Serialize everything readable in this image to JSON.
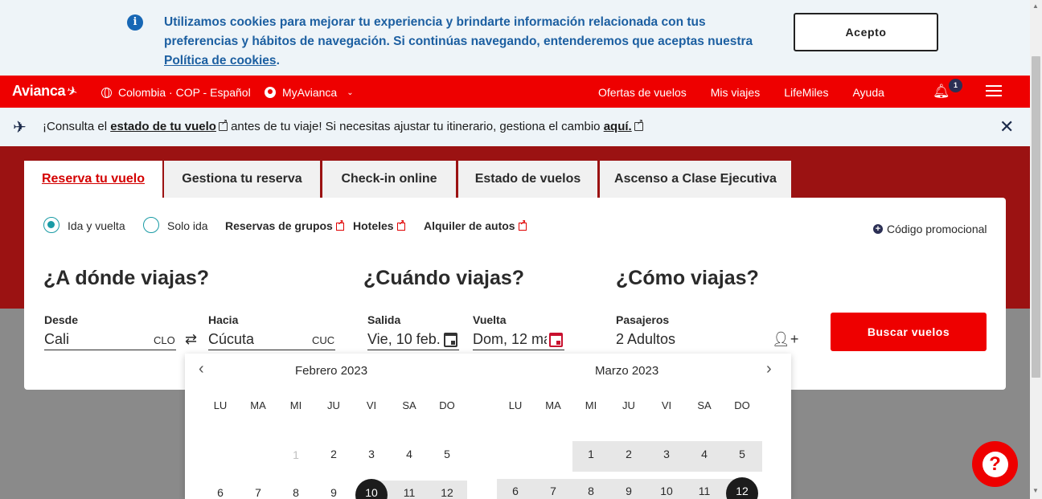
{
  "cookie": {
    "text": "Utilizamos cookies para mejorar tu experiencia y brindarte información relacionada con tus preferencias y hábitos de navegación. Si continúas navegando, entenderemos que aceptas nuestra",
    "link": "Política de cookies",
    "period": ".",
    "accept": "Acepto"
  },
  "nav": {
    "logo": "Avianca",
    "locale": "Colombia · COP - Español",
    "myavianca": "MyAvianca",
    "links": [
      "Ofertas de vuelos",
      "Mis viajes",
      "LifeMiles",
      "Ayuda"
    ],
    "notifications": "1"
  },
  "notice": {
    "pre": "¡Consulta el",
    "link1": "estado de tu vuelo",
    "mid": "antes de tu viaje! Si necesitas ajustar tu itinerario, gestiona el cambio",
    "link2": "aquí."
  },
  "tabs": [
    "Reserva tu vuelo",
    "Gestiona tu reserva",
    "Check-in online",
    "Estado de vuelos",
    "Ascenso a Clase Ejecutiva"
  ],
  "options": {
    "roundtrip": "Ida y vuelta",
    "oneway": "Solo ida",
    "groups": "Reservas de grupos",
    "hotels": "Hoteles",
    "cars": "Alquiler de autos",
    "promo": "Código promocional"
  },
  "headings": {
    "where": "¿A dónde viajas?",
    "when": "¿Cuándo viajas?",
    "how": "¿Cómo viajas?"
  },
  "fields": {
    "from_label": "Desde",
    "from_value": "Cali",
    "from_code": "CLO",
    "to_label": "Hacia",
    "to_value": "Cúcuta",
    "to_code": "CUC",
    "depart_label": "Salida",
    "depart_value": "Vie, 10 feb.",
    "return_label": "Vuelta",
    "return_value": "Dom, 12 ma",
    "pax_label": "Pasajeros",
    "pax_value": "2 Adultos",
    "search": "Buscar vuelos"
  },
  "calendar": {
    "left_month": "Febrero 2023",
    "right_month": "Marzo 2023",
    "dow": [
      "LU",
      "MA",
      "MI",
      "JU",
      "VI",
      "SA",
      "DO"
    ],
    "feb_row1": [
      "1",
      "2",
      "3",
      "4",
      "5"
    ],
    "feb_row2": [
      "6",
      "7",
      "8",
      "9",
      "10",
      "11",
      "12"
    ],
    "mar_row1": [
      "1",
      "2",
      "3",
      "4",
      "5"
    ],
    "mar_row2": [
      "6",
      "7",
      "8",
      "9",
      "10",
      "11",
      "12"
    ]
  }
}
